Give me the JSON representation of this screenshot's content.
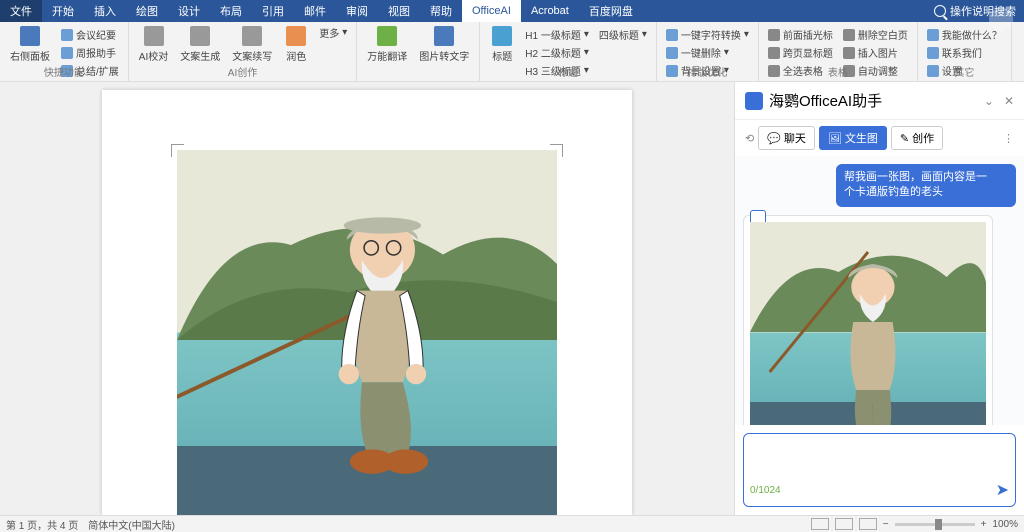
{
  "tabs": {
    "file": "文件",
    "items": [
      "开始",
      "插入",
      "绘图",
      "设计",
      "布局",
      "引用",
      "邮件",
      "审阅",
      "视图",
      "帮助",
      "OfficeAI",
      "Acrobat",
      "百度网盘"
    ],
    "active": "OfficeAI"
  },
  "search": "操作说明搜索",
  "ribbon": {
    "g1": {
      "label": "快捷功能",
      "btn": "右侧面板",
      "items": [
        "会议纪要",
        "周报助手",
        "总结/扩展"
      ]
    },
    "g2": {
      "label": "AI创作",
      "btns": [
        "AI校对",
        "文案生成",
        "文案续写",
        "润色"
      ],
      "more": "更多"
    },
    "g3": {
      "label": "",
      "btns": [
        "万能翻译",
        "图片转文字"
      ]
    },
    "g4": {
      "label": "标题",
      "btn": "标题",
      "h": [
        "H1 一级标题",
        "H2 二级标题",
        "H3 三级标题",
        "四级标题"
      ]
    },
    "g5": {
      "label": "排版优化",
      "items": [
        "一键字符转换",
        "一键删除",
        "背景设置"
      ]
    },
    "g6": {
      "label": "表格",
      "items": [
        "前面插光标",
        "跨页显标题",
        "全选表格",
        "删除空白页",
        "插入图片",
        "自动调整"
      ]
    },
    "g7": {
      "label": "其它",
      "btn": "设置",
      "items": [
        "我能做什么？",
        "联系我们"
      ]
    }
  },
  "assistant": {
    "title": "海鹦OfficeAI助手",
    "tabs": {
      "chat": "聊天",
      "txt2img": "文生图",
      "create": "创作"
    },
    "user_msg": "帮我画一张图，画面内容是一个卡通版钓鱼的老头",
    "counter": "0/1024"
  },
  "status": {
    "page": "第 1 页，共 4 页",
    "lang": "简体中文(中国大陆)",
    "zoom": "100%"
  }
}
